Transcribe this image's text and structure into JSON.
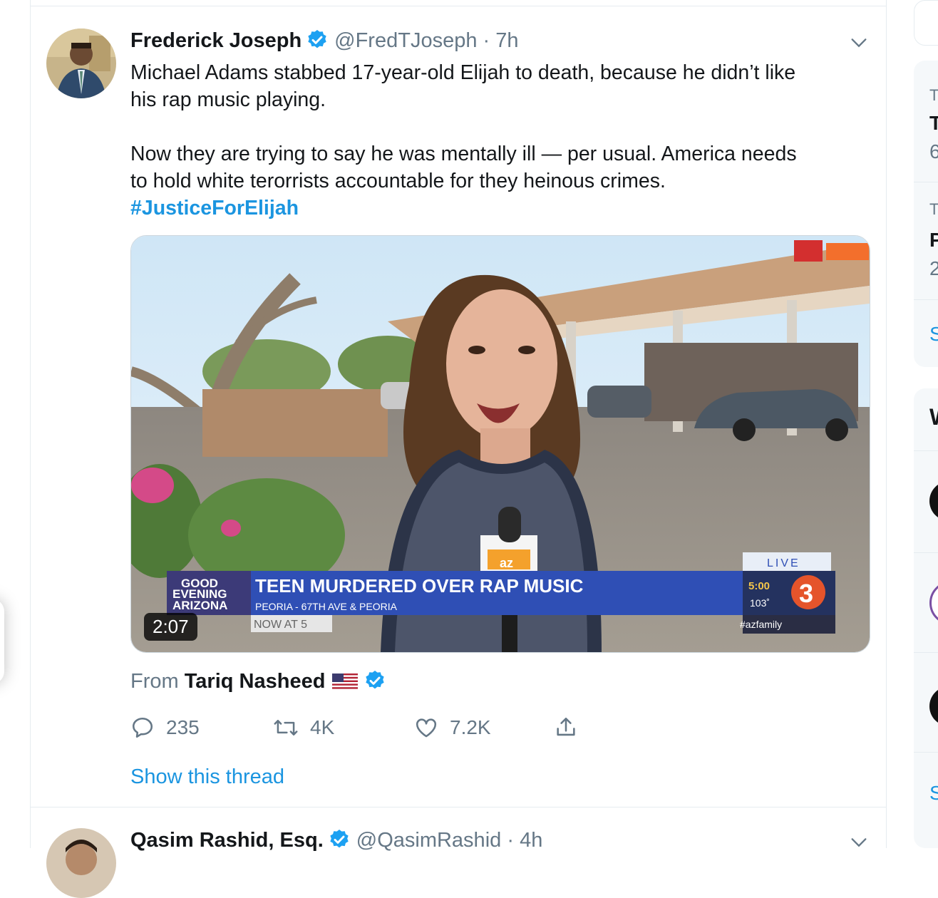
{
  "tweet1": {
    "display_name": "Frederick Joseph",
    "handle": "@FredTJoseph",
    "separator": "·",
    "time": "7h",
    "text_line1": "Michael Adams stabbed 17-year-old  Elijah to death, because he didn’t like",
    "text_line2": "his rap music playing.",
    "text_line3": "Now they are trying to say he was mentally ill — per usual. America needs",
    "text_line4": "to hold white terorrists accountable for they heinous crimes.",
    "hashtag": "#JusticeForElijah",
    "video": {
      "duration": "2:07",
      "chyron_show_top": "GOOD",
      "chyron_show_mid": "EVENING",
      "chyron_show_bottom": "ARIZONA",
      "headline": "TEEN MURDERED OVER RAP MUSIC",
      "location": "PEORIA - 67TH AVE & PEORIA",
      "next": "NOW AT 5",
      "live": "LIVE",
      "clock": "5:00",
      "temperature": "103˚",
      "channel_number": "3",
      "social": "#azfamily",
      "mic_flag": "az"
    },
    "from_label": "From",
    "from_name": "Tariq Nasheed",
    "stats": {
      "replies": "235",
      "retweets": "4K",
      "likes": "7.2K"
    },
    "show_thread": "Show this thread",
    "icons": [
      "verified-badge-icon",
      "chevron-down-icon",
      "reply-icon",
      "retweet-icon",
      "like-icon",
      "share-icon",
      "us-flag-icon"
    ]
  },
  "tweet2": {
    "display_name": "Qasim Rashid, Esq.",
    "handle": "@QasimRashid",
    "separator": "·",
    "time": "4h"
  },
  "sidebar": {
    "fragments": [
      "T",
      "T",
      "6",
      "T",
      "P",
      "2",
      "S",
      "W",
      "S"
    ]
  },
  "colors": {
    "link": "#1b95e0",
    "verified": "#1da1f2",
    "secondary_text": "#657786",
    "border": "#e6ecf0"
  }
}
